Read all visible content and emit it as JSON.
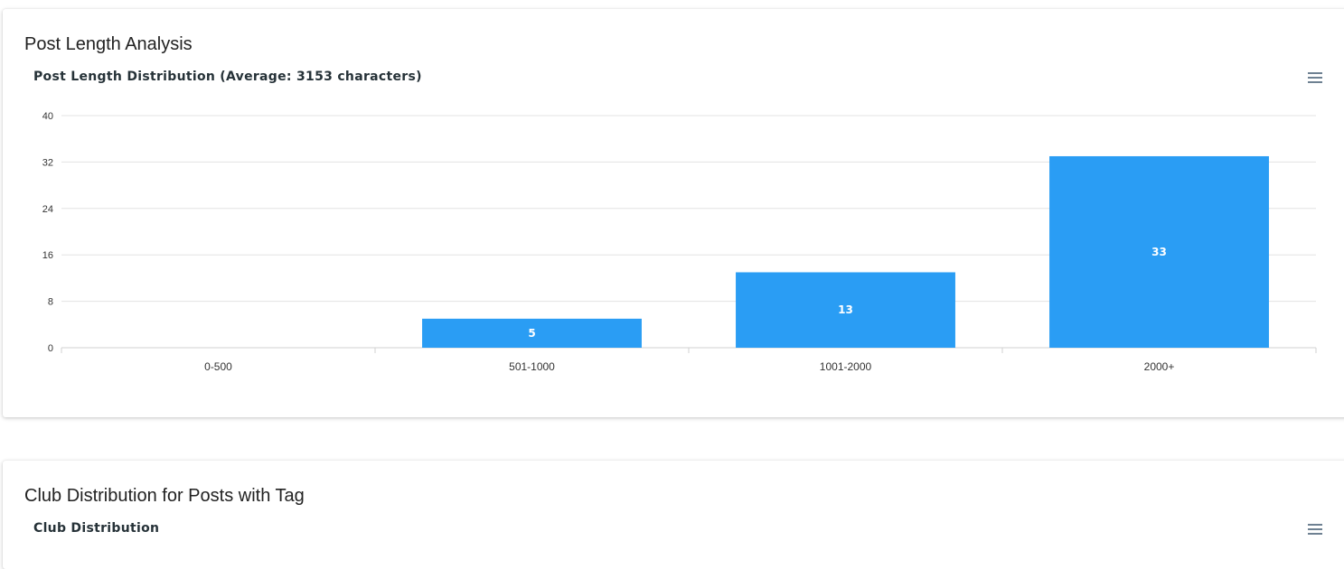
{
  "cards": [
    {
      "title": "Post Length Analysis",
      "chart_title": "Post Length Distribution (Average: 3153 characters)"
    },
    {
      "title": "Club Distribution for Posts with Tag",
      "chart_title": "Club Distribution"
    }
  ],
  "colors": {
    "bar": "#2a9df4",
    "grid": "#e3e3e3",
    "axis_text": "#333333",
    "bar_label": "#ffffff"
  },
  "chart_data": {
    "type": "bar",
    "title": "Post Length Distribution (Average: 3153 characters)",
    "categories": [
      "0-500",
      "501-1000",
      "1001-2000",
      "2000+"
    ],
    "values": [
      0,
      5,
      13,
      33
    ],
    "data_labels": [
      "",
      "5",
      "13",
      "33"
    ],
    "yticks": [
      "0",
      "8",
      "16",
      "24",
      "32",
      "40"
    ],
    "ylim": [
      0,
      40
    ],
    "grid": true,
    "xlabel": "",
    "ylabel": ""
  }
}
